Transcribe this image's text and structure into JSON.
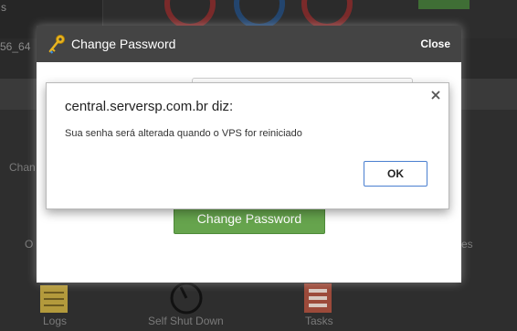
{
  "background": {
    "frag_s": "s",
    "frag_arch": "56_64",
    "tile_left_1": "Chan",
    "tile_left_2": "O",
    "tile_right": "es",
    "logs_label": "Logs",
    "shutdown_label": "Self Shut Down",
    "tasks_label": "Tasks"
  },
  "modal": {
    "title": "Change Password",
    "close_label": "Close",
    "submit_label": "Change Password"
  },
  "alert": {
    "origin": "central.serversp.com.br diz:",
    "message": "Sua senha será alterada quando o VPS for reiniciado",
    "ok_label": "OK"
  },
  "colors": {
    "modal_header": "#444444",
    "submit_green": "#66a44d",
    "ok_border": "#4a7fd0"
  }
}
